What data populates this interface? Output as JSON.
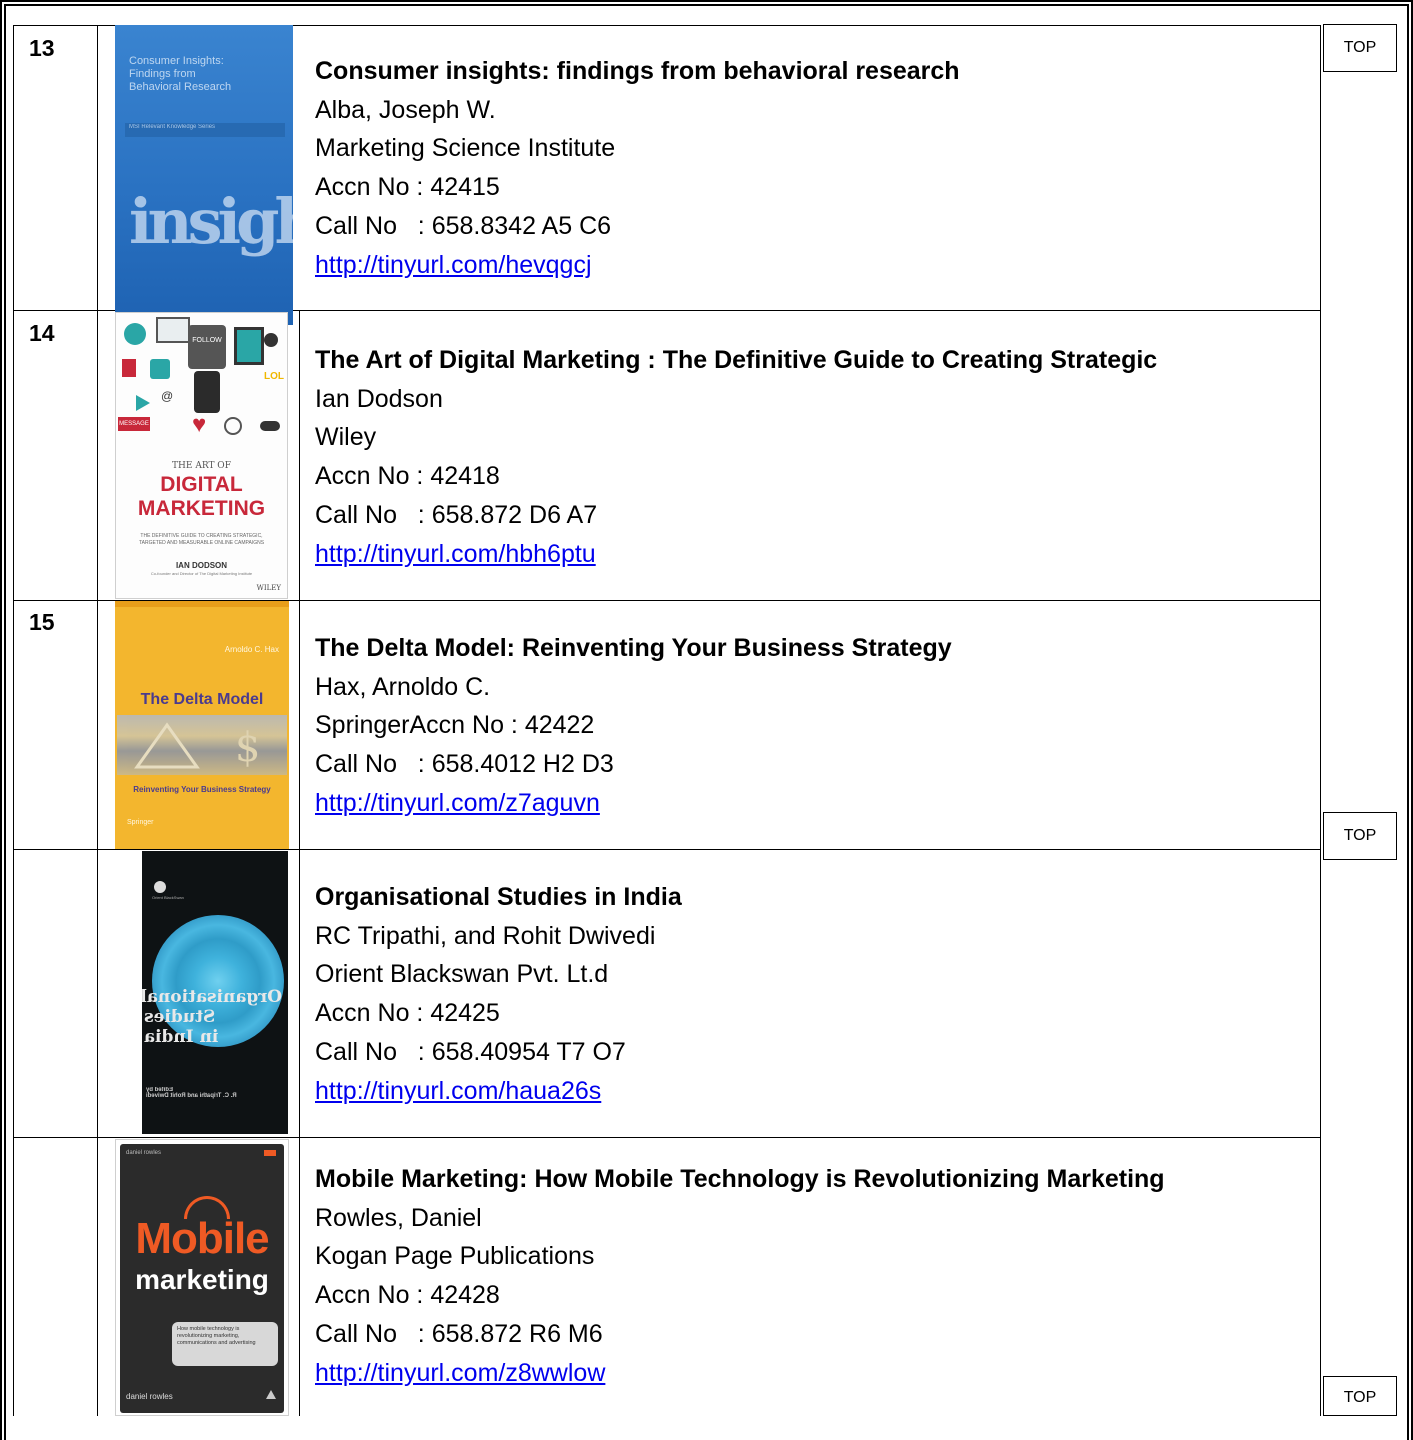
{
  "top_label": "TOP",
  "books": [
    {
      "num": "13",
      "title": "Consumer insights: findings from behavioral research",
      "author": "Alba, Joseph W.",
      "publisher": "Marketing Science Institute",
      "accn": "Accn No : 42415",
      "call": "Call No   : 658.8342 A5 C6",
      "url": "http://tinyurl.com/hevqgcj",
      "cover": {
        "title_lines": [
          "Consumer Insights:",
          "Findings from",
          "Behavioral Research"
        ],
        "subtitle": "MSI Relevant Knowledge Series",
        "big_word": "insights",
        "colors": {
          "bg": "#2a74c4",
          "text": "#cfe1f5"
        }
      }
    },
    {
      "num": "14",
      "title": "The Art of Digital Marketing : The Definitive Guide to Creating Strategic",
      "author": "Ian Dodson",
      "publisher": "Wiley",
      "accn": "Accn No : 42418",
      "call": "Call No   : 658.872 D6 A7",
      "url": "http://tinyurl.com/hbh6ptu",
      "cover": {
        "small": "THE ART OF",
        "line1": "DIGITAL",
        "line2": "MARKETING",
        "tagline1": "THE DEFINITIVE GUIDE TO CREATING STRATEGIC,",
        "tagline2": "TARGETED AND MEASURABLE ONLINE CAMPAIGNS",
        "author": "IAN DODSON",
        "author_sub": "Co-founder and Director of The Digital Marketing Institute",
        "publisher": "WILEY",
        "icon_follow": "FOLLOW",
        "icon_message": "MESSAGE",
        "icon_lol": "LOL",
        "colors": {
          "accent": "#c8283a",
          "teal": "#2aa6a6"
        }
      }
    },
    {
      "num": "15",
      "title": "The Delta Model: Reinventing Your Business Strategy",
      "author": "Hax, Arnoldo C.",
      "publisher": "SpringerAccn No : 42422",
      "accn": "",
      "call": "Call No   : 658.4012 H2 D3",
      "url": "http://tinyurl.com/z7aguvn",
      "cover": {
        "author": "Arnoldo C. Hax",
        "title": "The Delta Model",
        "subtitle": "Reinventing Your Business Strategy",
        "publisher": "Springer",
        "colors": {
          "bg": "#f3b62e",
          "title": "#4a3b8f"
        }
      }
    },
    {
      "num": "",
      "title": "Organisational Studies in India",
      "author": "RC Tripathi, and Rohit Dwivedi",
      "publisher": "Orient Blackswan Pvt. Lt.d",
      "accn": "Accn No : 42425",
      "call": "Call No   : 658.40954 T7 O7",
      "url": "http://tinyurl.com/haua26s",
      "cover": {
        "title_lines": [
          "Organisational",
          "Studies",
          "in India"
        ],
        "edited": "Edited by",
        "editors": "R. C. Tripathi and Rohit Dwivedi",
        "publisher": "Orient BlackSwan",
        "colors": {
          "bg": "#0e1214",
          "ring": "#3fb2dc"
        }
      }
    },
    {
      "num": "",
      "title": "Mobile Marketing: How Mobile Technology is Revolutionizing Marketing",
      "author": "Rowles, Daniel",
      "publisher": "Kogan Page Publications",
      "accn": "Accn No : 42428",
      "call": "Call No   : 658.872 R6 M6",
      "url": "http://tinyurl.com/z8wwlow",
      "cover": {
        "top": "daniel rowles",
        "big": "Mobile",
        "sub": "marketing",
        "bubble": "How mobile technology is revolutionizing marketing, communications and advertising",
        "bottom": "daniel rowles",
        "colors": {
          "bg": "#2b2b2b",
          "orange": "#ef5a24"
        }
      }
    }
  ]
}
